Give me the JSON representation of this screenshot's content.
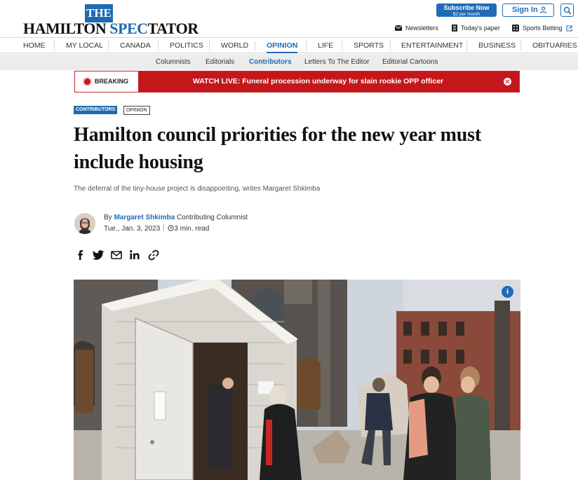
{
  "header": {
    "logo_the": "THE",
    "logo_main_a": "HAMILTON ",
    "logo_main_b": "SPEC",
    "logo_main_c": "TATOR",
    "subscribe_label": "Subscribe Now",
    "subscribe_price": "$2 per month",
    "signin_label": "Sign In",
    "utility": {
      "newsletters": "Newsletters",
      "todays_paper": "Today's paper",
      "sports_betting": "Sports Betting"
    }
  },
  "main_nav": [
    "HOME",
    "MY LOCAL",
    "CANADA",
    "POLITICS",
    "WORLD",
    "OPINION",
    "LIFE",
    "SPORTS",
    "ENTERTAINMENT",
    "BUSINESS",
    "OBITUARIES"
  ],
  "main_nav_active": "OPINION",
  "sub_nav": [
    "Columnists",
    "Editorials",
    "Contributors",
    "Letters To The Editor",
    "Editorial Cartoons"
  ],
  "sub_nav_active": "Contributors",
  "breaking": {
    "label": "BREAKING",
    "headline": "WATCH LIVE: Funeral procession underway for slain rookie OPP officer"
  },
  "article": {
    "tags": [
      "CONTRIBUTORS",
      "OPINION"
    ],
    "title": "Hamilton council priorities for the new year must include housing",
    "dek": "The deferral of the tiny-house project is disappointing, writes Margaret Shkimba",
    "by_prefix": "By",
    "author": "Margaret Shkimba",
    "author_role": "Contributing Columnist",
    "date": "Tue., Jan. 3, 2023",
    "read_time": "3 min. read"
  },
  "share_icons": [
    "facebook-icon",
    "twitter-icon",
    "email-icon",
    "linkedin-icon",
    "link-icon"
  ],
  "colors": {
    "brand_blue": "#1f6cb5",
    "breaking_red": "#c4171c",
    "subnav_bg": "#ececec"
  }
}
